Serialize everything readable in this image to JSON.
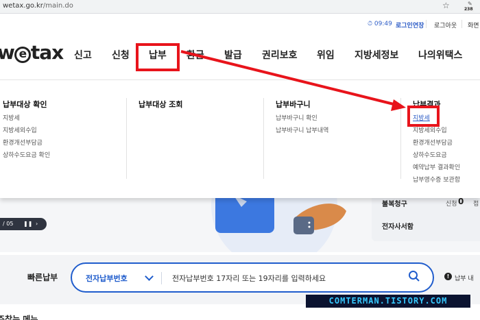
{
  "browser": {
    "url_host": "wetax.go.kr",
    "url_path": "/main.do",
    "extension_badge": "238"
  },
  "utility": {
    "timer": "09:49",
    "extend_login": "로그인연장",
    "logout": "로그아웃",
    "home": "화면"
  },
  "logo": {
    "left": "w",
    "circle": "e",
    "right": "tax"
  },
  "nav": [
    "신고",
    "신청",
    "납부",
    "환급",
    "발급",
    "권리보호",
    "위임",
    "지방세정보",
    "나의위택스"
  ],
  "mega_menu": {
    "columns": [
      {
        "title": "납부대상 확인",
        "items": [
          "지방세",
          "지방세외수입",
          "환경개선부담금",
          "상하수도요금 확인"
        ]
      },
      {
        "title": "납부대상 조회",
        "items": []
      },
      {
        "title": "납부바구니",
        "items": [
          "납부바구니 확인",
          "납부바구니 납부내역"
        ]
      },
      {
        "title": "납부결과",
        "items": [
          "지방세",
          "지방세외수입",
          "환경개선부담금",
          "상하수도요금",
          "예약납부 결과확인",
          "납부영수증 보관함"
        ]
      }
    ]
  },
  "hero": {
    "counter": "/ 05",
    "side_card": {
      "bulbok": "불복청구",
      "sinchung": "신청",
      "sinchung_count": "0",
      "jeop": "접",
      "jeonja": "전자사서함"
    }
  },
  "quick_pay": {
    "label": "빠른납부",
    "select_value": "전자납부번호",
    "placeholder": "전자납부번호 17자리 또는 19자리를 입력하세요",
    "notice": "납부 내"
  },
  "watermark": "COMTERMAN.TISTORY.COM",
  "bottom_heading": "주찾는 메뉴",
  "colors": {
    "accent": "#1f5ccc",
    "annotation": "#e8141b",
    "extend": "#2b5bc6"
  }
}
